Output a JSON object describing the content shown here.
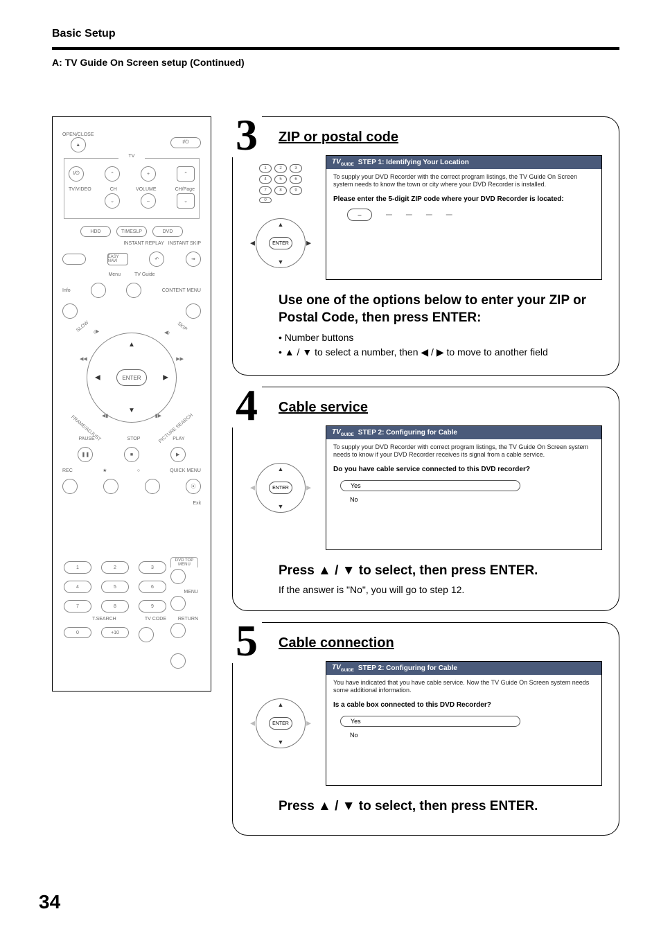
{
  "header": {
    "section": "Basic Setup",
    "subhead": "A: TV Guide On Screen setup (Continued)"
  },
  "page_number": "34",
  "remote": {
    "open_close": "OPEN/CLOSE",
    "power": "⏻",
    "tv_label": "TV",
    "tv_power": "⏻",
    "ch_up": "⌃",
    "plus": "+",
    "page_up": "⌃",
    "tvvideo": "TV/VIDEO",
    "ch": "CH",
    "volume": "VOLUME",
    "chpage": "CH/Page",
    "ch_down": "⌄",
    "minus": "–",
    "page_down": "⌄",
    "hdd": "HDD",
    "timeslp": "TIMESLP",
    "dvd": "DVD",
    "instant_replay": "INSTANT REPLAY",
    "instant_skip": "INSTANT SKIP",
    "easy_navi": "EASY NAVI",
    "menu": "Menu",
    "tvguide": "TV Guide",
    "info": "Info",
    "content_menu": "CONTENT MENU",
    "enter": "ENTER",
    "slow": "SLOW",
    "skip": "SKIP",
    "frame_adj": "FRAME/ADJUST",
    "pic_search": "PICTURE SEARCH",
    "pause": "PAUSE",
    "stop": "STOP",
    "play": "PLAY",
    "rec": "REC",
    "star": "★",
    "circle_o": "○",
    "quick_menu": "QUICK MENU",
    "exit": "Exit",
    "dvd_top_menu": "DVD TOP MENU",
    "menu2": "MENU",
    "return": "RETURN",
    "tsearch": "T.SEARCH",
    "tvcode": "TV CODE",
    "plus10": "+10"
  },
  "steps": {
    "s3": {
      "num": "3",
      "title": "ZIP or postal code",
      "screen_header": "STEP 1: Identifying Your Location",
      "screen_desc": "To supply your DVD Recorder with the correct program listings, the TV Guide On Screen system needs to know the town or city where your DVD Recorder is installed.",
      "screen_q": "Please enter the 5-digit ZIP code where your DVD Recorder is located:",
      "zip_placeholder": "–",
      "instr_h": "Use one of the options below to enter your ZIP or Postal Code, then press ENTER:",
      "instr_b1": "• Number buttons",
      "instr_b2": "• ▲ / ▼ to select a number, then ◀ / ▶ to move to another field"
    },
    "s4": {
      "num": "4",
      "title": "Cable service",
      "screen_header": "STEP 2: Configuring for Cable",
      "screen_desc": "To supply your DVD Recorder with correct program listings, the TV Guide On Screen system needs to know if your DVD Recorder receives its signal from a cable service.",
      "screen_q": "Do you have cable service connected to this DVD recorder?",
      "opt_yes": "Yes",
      "opt_no": "No",
      "instr_h": "Press ▲ / ▼ to select, then press ENTER.",
      "instr_p": "If the answer is \"No\", you will go to step 12."
    },
    "s5": {
      "num": "5",
      "title": "Cable connection",
      "screen_header": "STEP 2: Configuring for Cable",
      "screen_desc": "You have indicated that you have cable service. Now the TV Guide On Screen system needs some additional information.",
      "screen_q": "Is a cable box connected to this DVD Recorder?",
      "opt_yes": "Yes",
      "opt_no": "No",
      "instr_h": "Press ▲ / ▼ to select, then press ENTER."
    }
  },
  "ui": {
    "enter": "ENTER",
    "tv_logo": "TV",
    "tv_logo_sub": "GUIDE"
  }
}
